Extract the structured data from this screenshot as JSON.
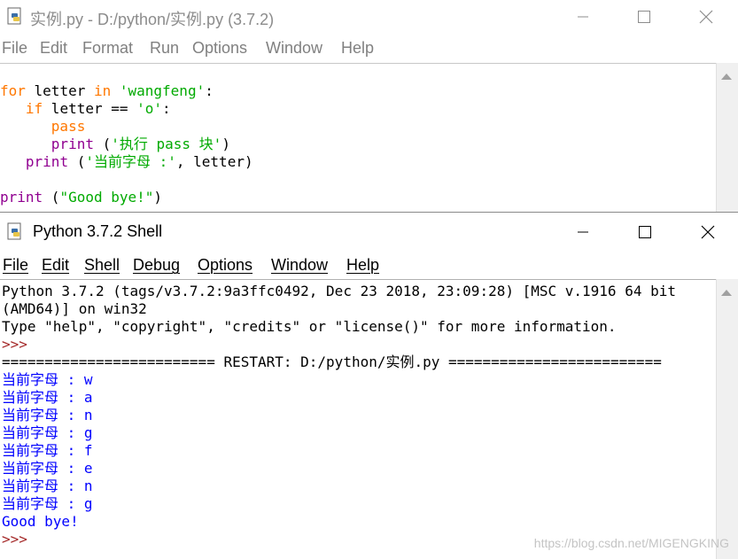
{
  "editor": {
    "title": "实例.py - D:/python/实例.py (3.7.2)",
    "menu": [
      "File",
      "Edit",
      "Format",
      "Run",
      "Options",
      "Window",
      "Help"
    ],
    "code": {
      "l1": {
        "kw1": "for",
        "t1": " letter ",
        "kw2": "in",
        "sp": " ",
        "s1": "'wangfeng'",
        "t2": ":"
      },
      "l2": {
        "indent": "   ",
        "kw": "if",
        "t1": " letter == ",
        "s1": "'o'",
        "t2": ":"
      },
      "l3": {
        "indent": "      ",
        "kw": "pass"
      },
      "l4": {
        "indent": "      ",
        "bi": "print",
        "t1": " (",
        "s1": "'执行 pass 块'",
        "t2": ")"
      },
      "l5": {
        "indent": "   ",
        "bi": "print",
        "t1": " (",
        "s1": "'当前字母 :'",
        "t2": ", letter)"
      },
      "l7": {
        "bi": "print",
        "t1": " (",
        "s1": "\"Good bye!\"",
        "t2": ")"
      }
    }
  },
  "shell": {
    "title": "Python 3.7.2 Shell",
    "menu": [
      "File",
      "Edit",
      "Shell",
      "Debug",
      "Options",
      "Window",
      "Help"
    ],
    "lines": [
      {
        "text": "Python 3.7.2 (tags/v3.7.2:9a3ffc0492, Dec 23 2018, 23:09:28) [MSC v.1916 64 bit",
        "style": "plain"
      },
      {
        "text": "(AMD64)] on win32",
        "style": "plain"
      },
      {
        "text": "Type \"help\", \"copyright\", \"credits\" or \"license()\" for more information.",
        "style": "plain"
      },
      {
        "text": ">>>",
        "style": "prompt"
      },
      {
        "text": "========================= RESTART: D:/python/实例.py =========================",
        "style": "restart"
      },
      {
        "text": "当前字母 : w",
        "style": "out"
      },
      {
        "text": "当前字母 : a",
        "style": "out"
      },
      {
        "text": "当前字母 : n",
        "style": "out"
      },
      {
        "text": "当前字母 : g",
        "style": "out"
      },
      {
        "text": "当前字母 : f",
        "style": "out"
      },
      {
        "text": "当前字母 : e",
        "style": "out"
      },
      {
        "text": "当前字母 : n",
        "style": "out"
      },
      {
        "text": "当前字母 : g",
        "style": "out"
      },
      {
        "text": "Good bye!",
        "style": "out"
      },
      {
        "text": ">>>",
        "style": "prompt"
      }
    ]
  },
  "watermark": "https://blog.csdn.net/MIGENGKING",
  "colors": {
    "keyword": "#ff7700",
    "string": "#00aa00",
    "builtin": "#900090",
    "output": "#0000ff",
    "prompt": "#a52a2a"
  },
  "icons": [
    "python-file-icon",
    "minimize-icon",
    "maximize-icon",
    "close-icon",
    "scroll-up-icon"
  ]
}
